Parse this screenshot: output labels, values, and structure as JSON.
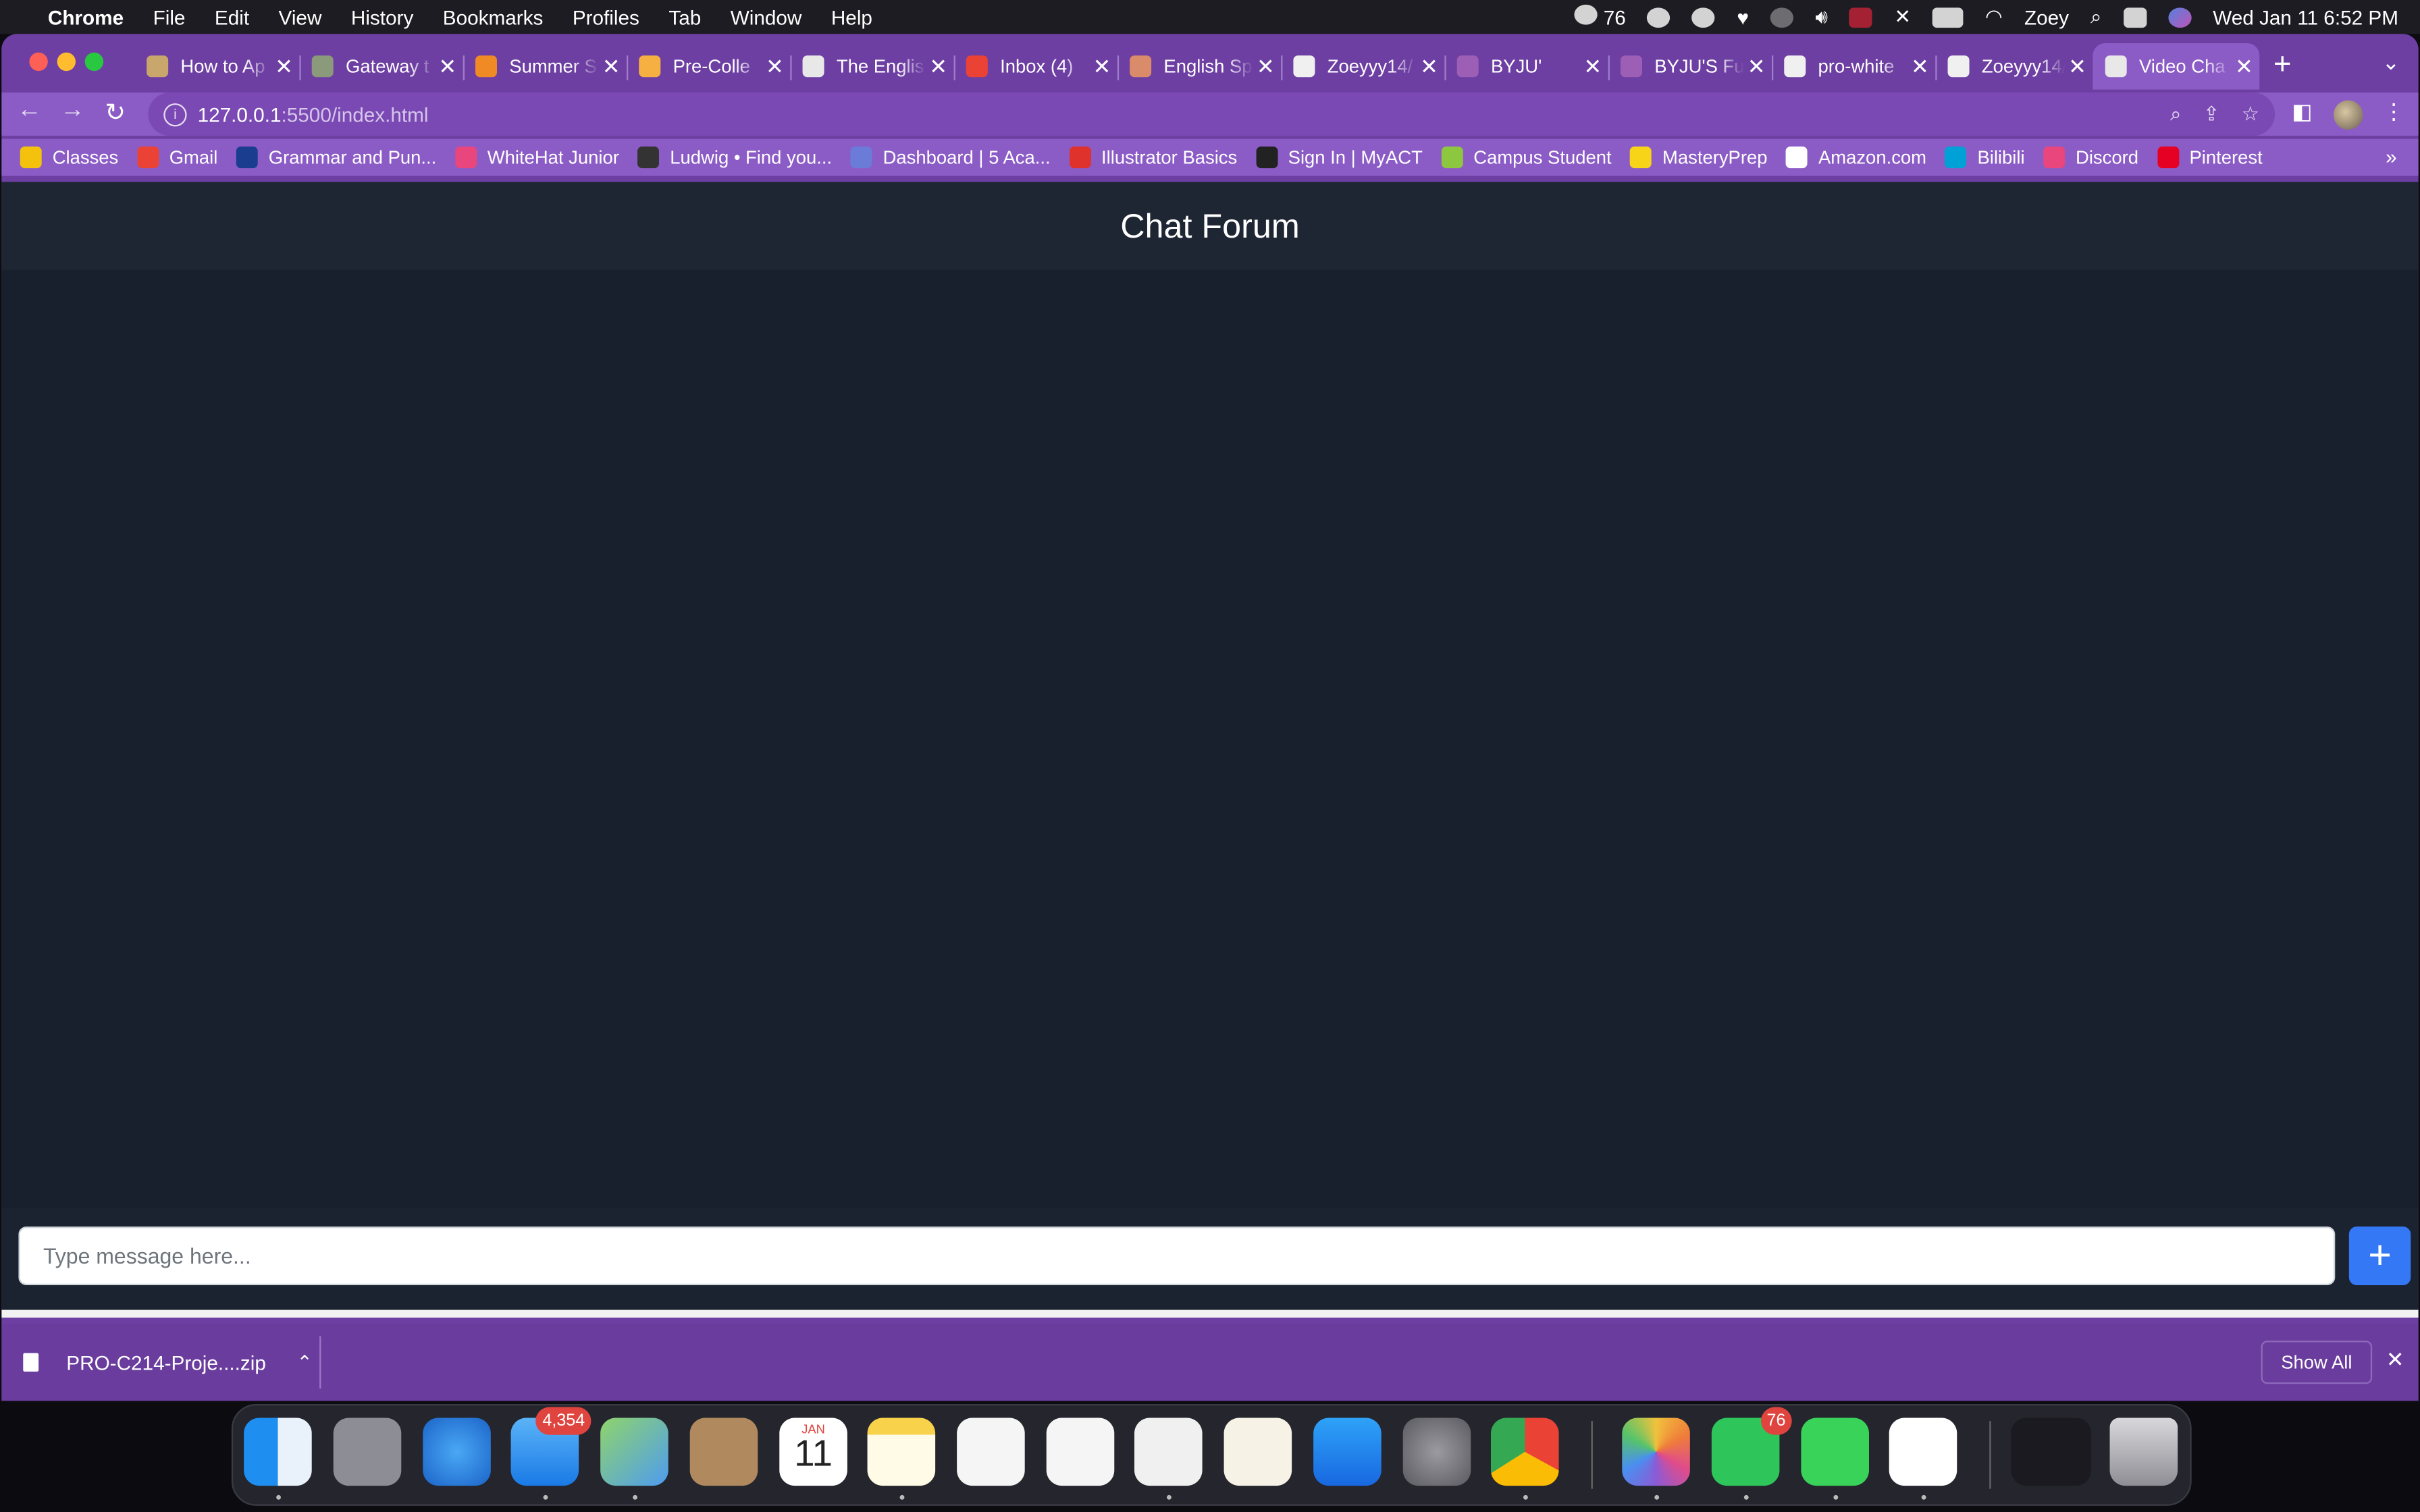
{
  "menubar": {
    "app": "Chrome",
    "items": [
      "File",
      "Edit",
      "View",
      "History",
      "Bookmarks",
      "Profiles",
      "Tab",
      "Window",
      "Help"
    ],
    "wechat_count": "76",
    "user": "Zoey",
    "datetime": "Wed Jan 11  6:52 PM"
  },
  "tabs": [
    {
      "title": "How to Ap",
      "color": "#c9a66b"
    },
    {
      "title": "Gateway t",
      "color": "#8a9a7b"
    },
    {
      "title": "Summer S",
      "color": "#f08a24"
    },
    {
      "title": "Pre-Colle",
      "color": "#f5b041"
    },
    {
      "title": "The Englis",
      "color": "#e8e8e8"
    },
    {
      "title": "Inbox (4)",
      "color": "#ea4335"
    },
    {
      "title": "English Sp",
      "color": "#d98b6a"
    },
    {
      "title": "Zoeyyy14/",
      "color": "#f0f0f0"
    },
    {
      "title": "BYJU'",
      "color": "#9c5fb5"
    },
    {
      "title": "BYJU'S Fu",
      "color": "#9c5fb5"
    },
    {
      "title": "pro-white",
      "color": "#f0f0f0"
    },
    {
      "title": "Zoeyyy14/",
      "color": "#f0f0f0"
    },
    {
      "title": "Video Cha",
      "color": "#e8e8e8"
    }
  ],
  "omnibox": {
    "host": "127.0.0.1",
    "path": ":5500/index.html"
  },
  "bookmarks": [
    {
      "label": "Classes",
      "color": "#f4c20d"
    },
    {
      "label": "Gmail",
      "color": "#ea4335"
    },
    {
      "label": "Grammar and Pun...",
      "color": "#1a3d8f"
    },
    {
      "label": "WhiteHat Junior",
      "color": "#e8467c"
    },
    {
      "label": "Ludwig • Find you...",
      "color": "#333333"
    },
    {
      "label": "Dashboard | 5 Aca...",
      "color": "#6a7bd8"
    },
    {
      "label": "Illustrator Basics",
      "color": "#e0322d"
    },
    {
      "label": "Sign In | MyACT",
      "color": "#222222"
    },
    {
      "label": "Campus Student",
      "color": "#8dc63f"
    },
    {
      "label": "MasteryPrep",
      "color": "#f7d417"
    },
    {
      "label": "Amazon.com",
      "color": "#ffffff"
    },
    {
      "label": "Bilibili",
      "color": "#00a1d6"
    },
    {
      "label": "Discord",
      "color": "#e8467c"
    },
    {
      "label": "Pinterest",
      "color": "#e60023"
    }
  ],
  "chat": {
    "title": "Chat Forum",
    "input_placeholder": "Type message here...",
    "send_label": "+"
  },
  "downloads": {
    "file": "PRO-C214-Proje....zip",
    "show_all": "Show All"
  },
  "dock": {
    "mail_badge": "4,354",
    "wechat_badge": "76",
    "calendar_month": "JAN",
    "calendar_day": "11"
  }
}
